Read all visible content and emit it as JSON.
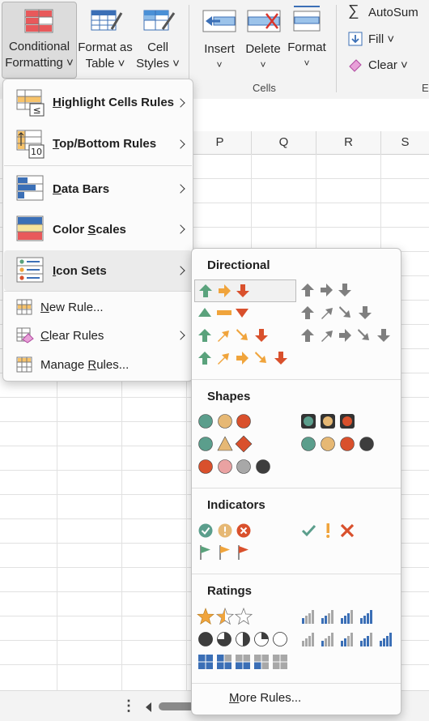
{
  "ribbon": {
    "conditional_formatting": {
      "line1": "Conditional",
      "line2": "Formatting ˅"
    },
    "format_as_table": {
      "line1": "Format as",
      "line2": "Table ˅"
    },
    "cell_styles": {
      "line1": "Cell",
      "line2": "Styles ˅"
    },
    "insert": {
      "line1": "Insert",
      "line2": "˅"
    },
    "delete": {
      "line1": "Delete",
      "line2": "˅"
    },
    "format": {
      "line1": "Format",
      "line2": "˅"
    },
    "cells_group_label": "Cells",
    "editing_group_label_partial": "E",
    "autosum": "AutoSum",
    "fill": "Fill ˅",
    "clear": "Clear ˅"
  },
  "grid": {
    "columns": [
      "P",
      "Q",
      "R",
      "S"
    ]
  },
  "menu": {
    "items": [
      {
        "label": "Highlight Cells Rules",
        "mnemonic": "H",
        "rest": "ighlight Cells Rules"
      },
      {
        "label": "Top/Bottom Rules",
        "mnemonic": "T",
        "rest": "op/Bottom Rules"
      },
      {
        "label": "Data Bars",
        "mnemonic": "D",
        "rest": "ata Bars"
      },
      {
        "label": "Color Scales",
        "pre": "Color ",
        "mnemonic": "S",
        "rest": "cales"
      },
      {
        "label": "Icon Sets",
        "mnemonic": "I",
        "rest": "con Sets"
      }
    ],
    "small_items": [
      {
        "label": "New Rule...",
        "mnemonic": "N",
        "rest": "ew Rule..."
      },
      {
        "label": "Clear Rules",
        "mnemonic": "C",
        "rest": "lear Rules"
      },
      {
        "label": "Manage Rules...",
        "pre": "Manage ",
        "mnemonic": "R",
        "rest": "ules..."
      }
    ],
    "icon_sets_highlighted": true
  },
  "submenu": {
    "sections": [
      "Directional",
      "Shapes",
      "Indicators",
      "Ratings"
    ],
    "more_rules": {
      "mnemonic": "M",
      "rest": "ore Rules..."
    },
    "selected_set": "3 Arrows (Colored)"
  },
  "colors": {
    "green": "#5aa27c",
    "yellow": "#f0a43c",
    "red": "#d9502c",
    "gray": "#7f7f7f",
    "blue": "#3b6fb6",
    "teal": "#5b9e8c"
  },
  "statusbar": {
    "menu_dots": "⋮"
  }
}
